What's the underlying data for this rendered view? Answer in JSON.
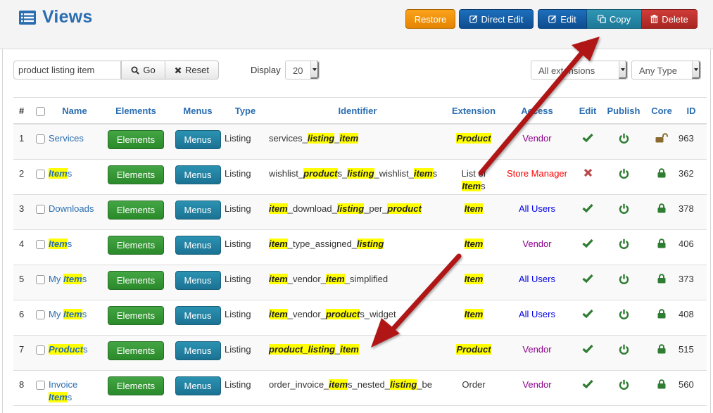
{
  "page": {
    "title": "Views",
    "title_icon": "list-icon"
  },
  "toolbar": {
    "restore_label": "Restore",
    "direct_edit_label": "Direct Edit",
    "edit_label": "Edit",
    "copy_label": "Copy",
    "delete_label": "Delete"
  },
  "filters": {
    "search_value": "product listing item",
    "go_label": "Go",
    "reset_label": "Reset",
    "display_label": "Display",
    "display_value": "20",
    "extension_value": "All extensions",
    "type_value": "Any Type"
  },
  "colors": {
    "title": "#2a6db0",
    "highlight": "#ffff00",
    "restore": "#f39200",
    "primary": "#1560a8",
    "copy": "#2a8aa8",
    "delete": "#bd302c",
    "elements": "#399739",
    "menus": "#2383a4",
    "access_vendor": "#8b008b",
    "access_store_manager": "#ff0000",
    "access_all_users": "#0000e6",
    "status_green": "#2e7d32",
    "status_red": "#b94a48",
    "unlocked": "#8a6a2e"
  },
  "table": {
    "headers": {
      "num": "#",
      "name": "Name",
      "elements": "Elements",
      "menus": "Menus",
      "type": "Type",
      "identifier": "Identifier",
      "extension": "Extension",
      "access": "Access",
      "edit": "Edit",
      "publish": "Publish",
      "core": "Core",
      "id": "ID"
    },
    "elements_button_label": "Elements",
    "menus_button_label": "Menus",
    "rows": [
      {
        "num": "1",
        "name": [
          {
            "t": "Services"
          }
        ],
        "type": "Listing",
        "identifier": [
          {
            "t": "services_"
          },
          {
            "t": "listing",
            "hl": true
          },
          {
            "t": "_"
          },
          {
            "t": "item",
            "hl": true
          }
        ],
        "extension": [
          {
            "t": "Product",
            "hl": true
          }
        ],
        "access": "Vendor",
        "access_class": "acc-vendor",
        "edit": "check",
        "publish": "power",
        "core": "unlocked",
        "id": "963"
      },
      {
        "num": "2",
        "name": [
          {
            "t": "Item",
            "hl": true
          },
          {
            "t": "s"
          }
        ],
        "type": "Listing",
        "identifier": [
          {
            "t": "wishlist_"
          },
          {
            "t": "product",
            "hl": true
          },
          {
            "t": "s_"
          },
          {
            "t": "listing",
            "hl": true
          },
          {
            "t": "_wishlist_"
          },
          {
            "t": "item",
            "hl": true
          },
          {
            "t": "s"
          }
        ],
        "extension": [
          {
            "t": "List of "
          },
          {
            "br": true
          },
          {
            "t": "Item",
            "hl": true
          },
          {
            "t": "s"
          }
        ],
        "access": "Store Manager",
        "access_class": "acc-store",
        "edit": "cross",
        "publish": "power",
        "core": "locked",
        "id": "362"
      },
      {
        "num": "3",
        "name": [
          {
            "t": "Downloads"
          }
        ],
        "type": "Listing",
        "identifier": [
          {
            "t": "item",
            "hl": true
          },
          {
            "t": "_download_"
          },
          {
            "t": "listing",
            "hl": true
          },
          {
            "t": "_per_"
          },
          {
            "t": "product",
            "hl": true
          }
        ],
        "extension": [
          {
            "t": "Item",
            "hl": true
          }
        ],
        "access": "All Users",
        "access_class": "acc-all",
        "edit": "check",
        "publish": "power",
        "core": "locked",
        "id": "378"
      },
      {
        "num": "4",
        "name": [
          {
            "t": "Item",
            "hl": true
          },
          {
            "t": "s"
          }
        ],
        "type": "Listing",
        "identifier": [
          {
            "t": "item",
            "hl": true
          },
          {
            "t": "_type_assigned_"
          },
          {
            "t": "listing",
            "hl": true
          }
        ],
        "extension": [
          {
            "t": "Item",
            "hl": true
          }
        ],
        "access": "Vendor",
        "access_class": "acc-vendor",
        "edit": "check",
        "publish": "power",
        "core": "locked",
        "id": "406"
      },
      {
        "num": "5",
        "name": [
          {
            "t": "My "
          },
          {
            "t": "Item",
            "hl": true
          },
          {
            "t": "s"
          }
        ],
        "type": "Listing",
        "identifier": [
          {
            "t": "item",
            "hl": true
          },
          {
            "t": "_vendor_"
          },
          {
            "t": "item",
            "hl": true
          },
          {
            "t": "_simplified"
          }
        ],
        "extension": [
          {
            "t": "Item",
            "hl": true
          }
        ],
        "access": "All Users",
        "access_class": "acc-all",
        "edit": "check",
        "publish": "power",
        "core": "locked",
        "id": "373"
      },
      {
        "num": "6",
        "name": [
          {
            "t": "My "
          },
          {
            "t": "Item",
            "hl": true
          },
          {
            "t": "s"
          }
        ],
        "type": "Listing",
        "identifier": [
          {
            "t": "item",
            "hl": true
          },
          {
            "t": "_vendor_"
          },
          {
            "t": "product",
            "hl": true
          },
          {
            "t": "s_widget"
          }
        ],
        "extension": [
          {
            "t": "Item",
            "hl": true
          }
        ],
        "access": "All Users",
        "access_class": "acc-all",
        "edit": "check",
        "publish": "power",
        "core": "locked",
        "id": "408"
      },
      {
        "num": "7",
        "name": [
          {
            "t": "Product",
            "hl": true
          },
          {
            "t": "s"
          }
        ],
        "type": "Listing",
        "identifier": [
          {
            "t": "product",
            "hl": true
          },
          {
            "t": "_",
            "hl": true
          },
          {
            "t": "listing",
            "hl": true
          },
          {
            "t": "_"
          },
          {
            "t": "item",
            "hl": true
          }
        ],
        "extension": [
          {
            "t": "Product",
            "hl": true
          }
        ],
        "access": "Vendor",
        "access_class": "acc-vendor",
        "edit": "check",
        "publish": "power",
        "core": "locked",
        "id": "515"
      },
      {
        "num": "8",
        "name": [
          {
            "t": "Invoice "
          },
          {
            "br": true
          },
          {
            "t": "Item",
            "hl": true
          },
          {
            "t": "s"
          }
        ],
        "type": "Listing",
        "identifier": [
          {
            "t": "order_invoice_"
          },
          {
            "t": "item",
            "hl": true
          },
          {
            "t": "s_nested_"
          },
          {
            "t": "listing",
            "hl": true
          },
          {
            "t": "_be"
          }
        ],
        "extension": [
          {
            "t": "Order"
          }
        ],
        "access": "Vendor",
        "access_class": "acc-vendor",
        "edit": "check",
        "publish": "power",
        "core": "locked",
        "id": "560"
      }
    ]
  },
  "annotations": {
    "arrows": [
      {
        "name": "arrow-to-copy-button",
        "points_to": "Copy"
      },
      {
        "name": "arrow-to-row-7",
        "points_to": "product_listing_item"
      }
    ]
  }
}
